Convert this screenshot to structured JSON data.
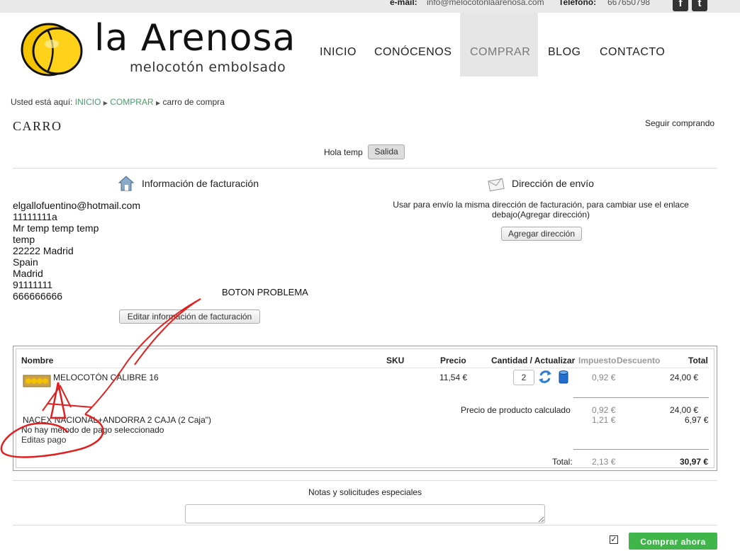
{
  "topbar": {
    "email_label": "e-mail:",
    "email_value": "info@melocotonlaarenosa.com",
    "phone_label": "Teléfono:",
    "phone_value": "667650798",
    "social": [
      {
        "icon": "facebook-icon",
        "glyph": "f"
      },
      {
        "icon": "twitter-icon",
        "glyph": "t"
      }
    ]
  },
  "logo": {
    "name": "la Arenosa",
    "tagline": "melocotón embolsado"
  },
  "nav": {
    "items": [
      "INICIO",
      "CONÓCENOS",
      "COMPRAR",
      "BLOG",
      "CONTACTO"
    ],
    "active": "COMPRAR"
  },
  "breadcrumb": {
    "prefix": "Usted está aquí:",
    "links": [
      "INICIO",
      "COMPRAR"
    ],
    "current": "carro de compra"
  },
  "page": {
    "title": "CARRO",
    "continue_link": "Seguir comprando"
  },
  "session": {
    "greeting": "Hola temp",
    "logout": "Salida"
  },
  "billing": {
    "title": "Información de facturación",
    "lines": [
      "elgallofuentino@hotmail.com",
      "11111111a",
      "Mr temp temp temp",
      "temp",
      "22222 Madrid",
      "Spain",
      "Madrid",
      "91111111",
      "666666666"
    ],
    "edit_button": "Editar información de facturación"
  },
  "shipping": {
    "title": "Dirección de envío",
    "note": "Usar para envío la misma dirección de facturación, para cambiar use el enlace debajo(Agregar dirección)",
    "add_button": "Agregar dirección"
  },
  "annotation": {
    "text": "BOTON PROBLEMA",
    "color": "#e02020"
  },
  "cart": {
    "headers": {
      "name": "Nombre",
      "sku": "SKU",
      "price": "Precio",
      "qty": "Cantidad / Actualizar",
      "tax": "Impuesto",
      "discount": "Descuento",
      "total": "Total"
    },
    "items": [
      {
        "name": "MELOCOTÓN CALIBRE 16",
        "price": "11,54 €",
        "qty": "2",
        "tax": "0,92 €",
        "total": "24,00 €"
      }
    ],
    "calc_label": "Precio de producto calculado",
    "calc_tax": "0,92 €",
    "calc_total": "24,00 €",
    "shipping_method": "NACEX NACIONAL+ANDORRA 2 CAJA (2 Caja\")",
    "shipping_tax": "1,21 €",
    "shipping_total": "6,97 €",
    "no_payment": "No hay método de pago seleccionado",
    "edit_payment": "Editas pago",
    "total_label": "Total:",
    "total_tax": "2,13 €",
    "grand_total": "30,97 €"
  },
  "notes": {
    "label": "Notas y solicitudes especiales",
    "value": ""
  },
  "checkout": {
    "button": "Comprar ahora",
    "checked": true
  }
}
